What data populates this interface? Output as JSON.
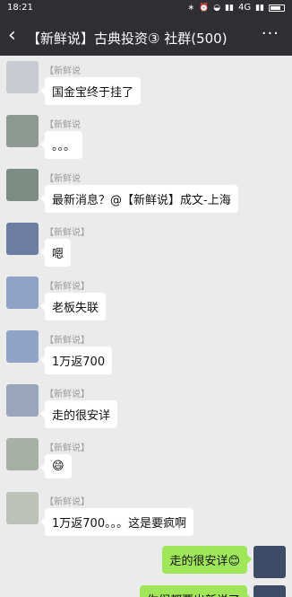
{
  "status_bar": {
    "time": "18:21",
    "left_icons": "… ✉ ☁",
    "right_icons": "∗ ⏰ ◒ ▮ ▮",
    "network": "4G",
    "colors": {
      "bg": "#2e2e33",
      "text": "#ffffff"
    }
  },
  "header": {
    "back_icon": "back-chevron-icon",
    "title": "【新鲜说】古典投资③ 社群(500)",
    "more_icon": "more-dots-icon"
  },
  "messages": [
    {
      "sender": "【新鲜说",
      "text": "国金宝终于挂了",
      "avatar_color": "#c8ccd2"
    },
    {
      "sender": "【新鲜说",
      "text": "。。。",
      "avatar_color": "#8d9992"
    },
    {
      "sender": "【新鲜说",
      "text": "最新消息？@【新鲜说】成文-上海",
      "avatar_color": "#7d8c84"
    },
    {
      "sender": "【新鲜说】",
      "text": "嗯",
      "avatar_color": "#6b7ea0"
    },
    {
      "sender": "【新鲜说】",
      "text": "老板失联",
      "avatar_color": "#8fa3c4"
    },
    {
      "sender": "【新鲜说】",
      "text": "1万返700",
      "avatar_color": "#90a4c6"
    },
    {
      "sender": "【新鲜说】",
      "text": "走的很安详",
      "avatar_color": "#98a5bb"
    },
    {
      "sender": "【新鲜说】",
      "text": "😄",
      "avatar_color": "#a6b0a4"
    },
    {
      "sender": "【新鲜说】",
      "text": "1万返700。。。这是要疯啊",
      "avatar_color": "#bcc2b9"
    }
  ],
  "my_messages": [
    {
      "text": "走的很安详😊",
      "avatar_color": "#3d4b67"
    },
    {
      "text": "你们都要出新说了",
      "avatar_color": "#3d4b67"
    }
  ],
  "colors": {
    "chat_bg": "#ebebeb",
    "bubble_in": "#ffffff",
    "bubble_out": "#9fe658"
  }
}
